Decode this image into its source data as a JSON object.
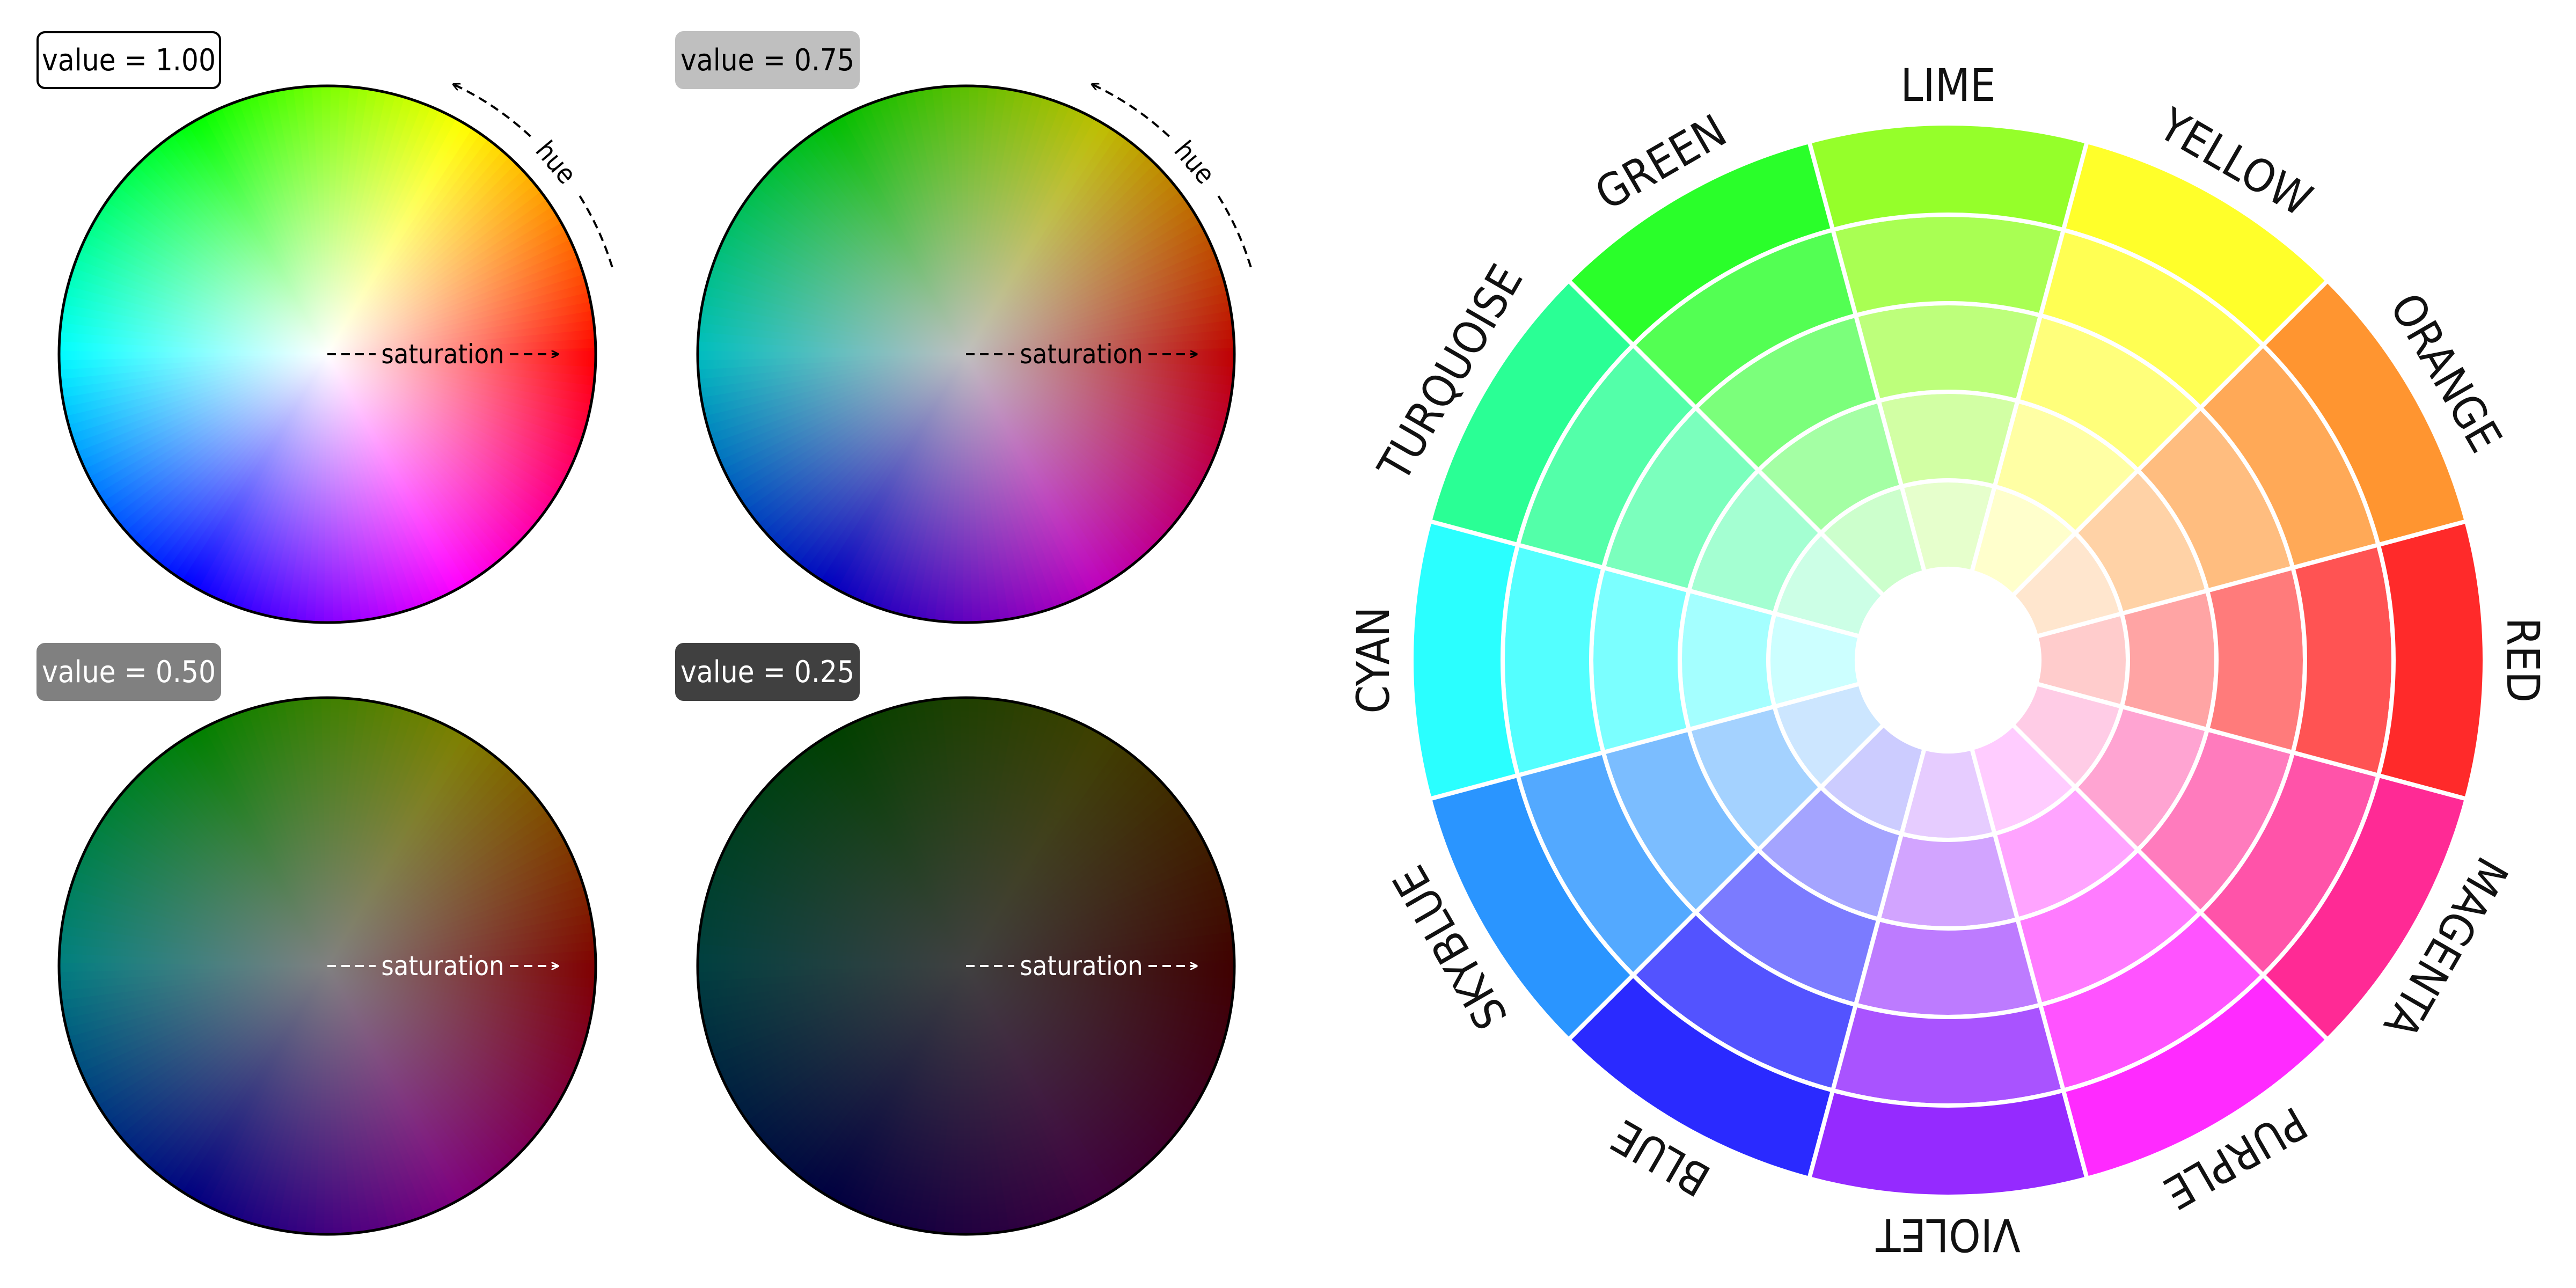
{
  "hsv_wheels": [
    {
      "id": "v100",
      "label": "value = 1.00",
      "value": 1.0,
      "badge_fill": "#ffffff",
      "badge_border": "#000000",
      "badge_text": "#000000",
      "annotation_color": "#000000",
      "hue_annotation": "hue",
      "saturation_annotation": "saturation",
      "show_hue": true
    },
    {
      "id": "v075",
      "label": "value = 0.75",
      "value": 0.75,
      "badge_fill": "#bfbfbf",
      "badge_border": "#bfbfbf",
      "badge_text": "#000000",
      "annotation_color": "#000000",
      "hue_annotation": "hue",
      "saturation_annotation": "saturation",
      "show_hue": true
    },
    {
      "id": "v050",
      "label": "value = 0.50",
      "value": 0.5,
      "badge_fill": "#808080",
      "badge_border": "#808080",
      "badge_text": "#ffffff",
      "annotation_color": "#ffffff",
      "hue_annotation": "hue",
      "saturation_annotation": "saturation",
      "show_hue": true
    },
    {
      "id": "v025",
      "label": "value = 0.25",
      "value": 0.25,
      "badge_fill": "#404040",
      "badge_border": "#404040",
      "badge_text": "#ffffff",
      "annotation_color": "#ffffff",
      "hue_annotation": "hue",
      "saturation_annotation": "saturation",
      "show_hue": true
    }
  ],
  "named_wheel": {
    "rings": 5,
    "segments": [
      {
        "name": "RED",
        "color": "#ff2a2a"
      },
      {
        "name": "ORANGE",
        "color": "#ff9530"
      },
      {
        "name": "YELLOW",
        "color": "#ffff2a"
      },
      {
        "name": "LIME",
        "color": "#95ff2a"
      },
      {
        "name": "GREEN",
        "color": "#2aff2a"
      },
      {
        "name": "TURQUOISE",
        "color": "#2aff95"
      },
      {
        "name": "CYAN",
        "color": "#2affff"
      },
      {
        "name": "SKYBLUE",
        "color": "#2a95ff"
      },
      {
        "name": "BLUE",
        "color": "#2a2aff"
      },
      {
        "name": "VIOLET",
        "color": "#952aff"
      },
      {
        "name": "PURPLE",
        "color": "#ff2aff"
      },
      {
        "name": "MAGENTA",
        "color": "#ff2a95"
      }
    ]
  }
}
